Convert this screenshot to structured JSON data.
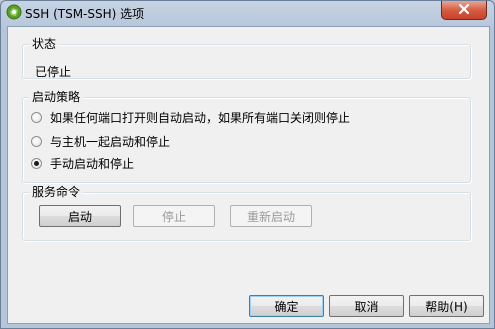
{
  "window": {
    "title": "SSH (TSM-SSH) 选项",
    "close_icon": "close-icon"
  },
  "status_group": {
    "label": "状态",
    "value": "已停止"
  },
  "policy_group": {
    "label": "启动策略",
    "options": [
      {
        "label": "如果任何端口打开则自动启动，如果所有端口关闭则停止",
        "checked": false
      },
      {
        "label": "与主机一起启动和停止",
        "checked": false
      },
      {
        "label": "手动启动和停止",
        "checked": true
      }
    ]
  },
  "commands_group": {
    "label": "服务命令",
    "start": "启动",
    "stop": "停止",
    "restart": "重新启动"
  },
  "footer": {
    "ok": "确定",
    "cancel": "取消",
    "help": "帮助(H)"
  }
}
